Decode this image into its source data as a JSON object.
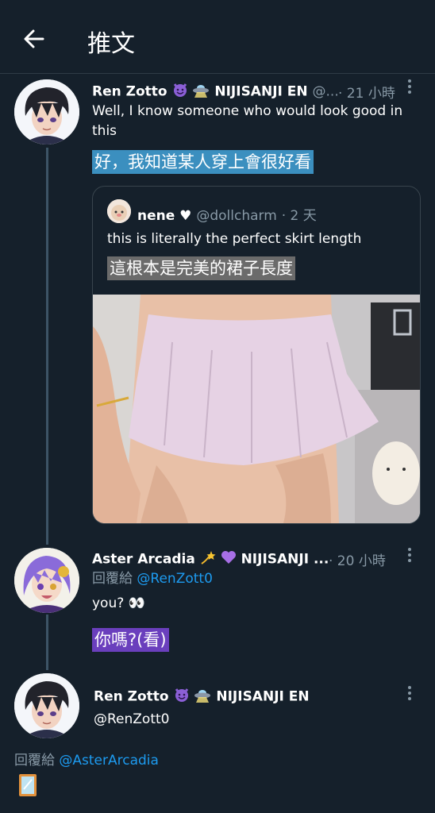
{
  "header": {
    "title": "推文",
    "back_icon": "arrow-left-icon"
  },
  "tweets": [
    {
      "name": "Ren Zotto",
      "badges": [
        "smiling-devil-emoji",
        "ufo-emoji"
      ],
      "affiliation": "NIJISANJI EN",
      "handle_trunc": "@...",
      "time": "· 21 小時",
      "text": "Well, I know someone who would look good in this",
      "translation": "好，我知道某人穿上會很好看",
      "translation_bg": "#3b8fbf",
      "quote": {
        "name": "nene ♥",
        "handle": "@dollcharm",
        "time": "· 2 天",
        "text": "this is literally the perfect skirt length",
        "translation": "這根本是完美的裙子長度",
        "translation_bg": "#6b6b6b"
      }
    },
    {
      "name": "Aster Arcadia",
      "badges": [
        "dizzy-emoji",
        "purple-heart-emoji"
      ],
      "affiliation": "NIJISANJI ...",
      "time": "· 20 小時",
      "reply_prefix": "回覆給",
      "reply_to": "@RenZott0",
      "text": "you? 👀",
      "translation": "你嗎?(看)",
      "translation_bg": "#6a3fbd"
    },
    {
      "name": "Ren Zotto",
      "badges": [
        "smiling-devil-emoji",
        "ufo-emoji"
      ],
      "affiliation": "NIJISANJI EN",
      "handle": "@RenZott0",
      "reply_prefix": "回覆給",
      "reply_to": "@AsterArcadia",
      "text_icon": "mirror-emoji"
    }
  ],
  "colors": {
    "background": "#15202b",
    "muted": "#8899a6",
    "link": "#1d9bf0",
    "border": "#38444d"
  }
}
